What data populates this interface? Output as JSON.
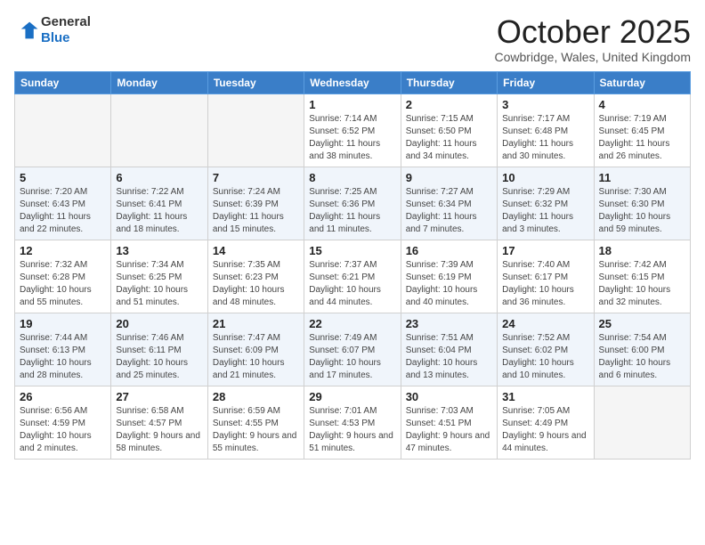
{
  "header": {
    "logo": {
      "line1": "General",
      "line2": "Blue"
    },
    "title": "October 2025",
    "location": "Cowbridge, Wales, United Kingdom"
  },
  "weekdays": [
    "Sunday",
    "Monday",
    "Tuesday",
    "Wednesday",
    "Thursday",
    "Friday",
    "Saturday"
  ],
  "weeks": [
    [
      {
        "day": "",
        "info": ""
      },
      {
        "day": "",
        "info": ""
      },
      {
        "day": "",
        "info": ""
      },
      {
        "day": "1",
        "info": "Sunrise: 7:14 AM\nSunset: 6:52 PM\nDaylight: 11 hours and 38 minutes."
      },
      {
        "day": "2",
        "info": "Sunrise: 7:15 AM\nSunset: 6:50 PM\nDaylight: 11 hours and 34 minutes."
      },
      {
        "day": "3",
        "info": "Sunrise: 7:17 AM\nSunset: 6:48 PM\nDaylight: 11 hours and 30 minutes."
      },
      {
        "day": "4",
        "info": "Sunrise: 7:19 AM\nSunset: 6:45 PM\nDaylight: 11 hours and 26 minutes."
      }
    ],
    [
      {
        "day": "5",
        "info": "Sunrise: 7:20 AM\nSunset: 6:43 PM\nDaylight: 11 hours and 22 minutes."
      },
      {
        "day": "6",
        "info": "Sunrise: 7:22 AM\nSunset: 6:41 PM\nDaylight: 11 hours and 18 minutes."
      },
      {
        "day": "7",
        "info": "Sunrise: 7:24 AM\nSunset: 6:39 PM\nDaylight: 11 hours and 15 minutes."
      },
      {
        "day": "8",
        "info": "Sunrise: 7:25 AM\nSunset: 6:36 PM\nDaylight: 11 hours and 11 minutes."
      },
      {
        "day": "9",
        "info": "Sunrise: 7:27 AM\nSunset: 6:34 PM\nDaylight: 11 hours and 7 minutes."
      },
      {
        "day": "10",
        "info": "Sunrise: 7:29 AM\nSunset: 6:32 PM\nDaylight: 11 hours and 3 minutes."
      },
      {
        "day": "11",
        "info": "Sunrise: 7:30 AM\nSunset: 6:30 PM\nDaylight: 10 hours and 59 minutes."
      }
    ],
    [
      {
        "day": "12",
        "info": "Sunrise: 7:32 AM\nSunset: 6:28 PM\nDaylight: 10 hours and 55 minutes."
      },
      {
        "day": "13",
        "info": "Sunrise: 7:34 AM\nSunset: 6:25 PM\nDaylight: 10 hours and 51 minutes."
      },
      {
        "day": "14",
        "info": "Sunrise: 7:35 AM\nSunset: 6:23 PM\nDaylight: 10 hours and 48 minutes."
      },
      {
        "day": "15",
        "info": "Sunrise: 7:37 AM\nSunset: 6:21 PM\nDaylight: 10 hours and 44 minutes."
      },
      {
        "day": "16",
        "info": "Sunrise: 7:39 AM\nSunset: 6:19 PM\nDaylight: 10 hours and 40 minutes."
      },
      {
        "day": "17",
        "info": "Sunrise: 7:40 AM\nSunset: 6:17 PM\nDaylight: 10 hours and 36 minutes."
      },
      {
        "day": "18",
        "info": "Sunrise: 7:42 AM\nSunset: 6:15 PM\nDaylight: 10 hours and 32 minutes."
      }
    ],
    [
      {
        "day": "19",
        "info": "Sunrise: 7:44 AM\nSunset: 6:13 PM\nDaylight: 10 hours and 28 minutes."
      },
      {
        "day": "20",
        "info": "Sunrise: 7:46 AM\nSunset: 6:11 PM\nDaylight: 10 hours and 25 minutes."
      },
      {
        "day": "21",
        "info": "Sunrise: 7:47 AM\nSunset: 6:09 PM\nDaylight: 10 hours and 21 minutes."
      },
      {
        "day": "22",
        "info": "Sunrise: 7:49 AM\nSunset: 6:07 PM\nDaylight: 10 hours and 17 minutes."
      },
      {
        "day": "23",
        "info": "Sunrise: 7:51 AM\nSunset: 6:04 PM\nDaylight: 10 hours and 13 minutes."
      },
      {
        "day": "24",
        "info": "Sunrise: 7:52 AM\nSunset: 6:02 PM\nDaylight: 10 hours and 10 minutes."
      },
      {
        "day": "25",
        "info": "Sunrise: 7:54 AM\nSunset: 6:00 PM\nDaylight: 10 hours and 6 minutes."
      }
    ],
    [
      {
        "day": "26",
        "info": "Sunrise: 6:56 AM\nSunset: 4:59 PM\nDaylight: 10 hours and 2 minutes."
      },
      {
        "day": "27",
        "info": "Sunrise: 6:58 AM\nSunset: 4:57 PM\nDaylight: 9 hours and 58 minutes."
      },
      {
        "day": "28",
        "info": "Sunrise: 6:59 AM\nSunset: 4:55 PM\nDaylight: 9 hours and 55 minutes."
      },
      {
        "day": "29",
        "info": "Sunrise: 7:01 AM\nSunset: 4:53 PM\nDaylight: 9 hours and 51 minutes."
      },
      {
        "day": "30",
        "info": "Sunrise: 7:03 AM\nSunset: 4:51 PM\nDaylight: 9 hours and 47 minutes."
      },
      {
        "day": "31",
        "info": "Sunrise: 7:05 AM\nSunset: 4:49 PM\nDaylight: 9 hours and 44 minutes."
      },
      {
        "day": "",
        "info": ""
      }
    ]
  ]
}
